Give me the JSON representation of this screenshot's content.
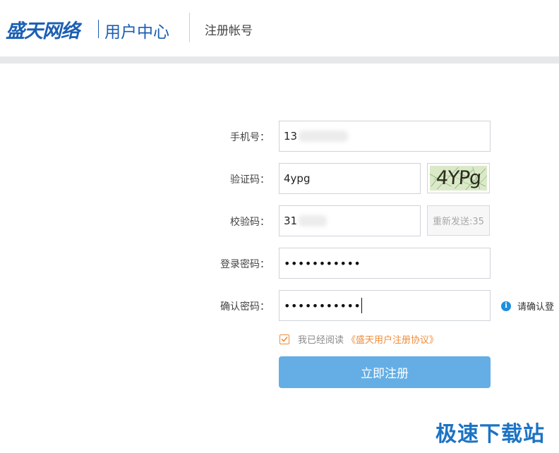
{
  "header": {
    "brand": "盛天网络",
    "subtitle": "用户中心",
    "page_title": "注册帐号"
  },
  "form": {
    "phone": {
      "label": "手机号：",
      "value": "13"
    },
    "captcha": {
      "label": "验证码：",
      "value": "4ypg",
      "image_text": "4YPg"
    },
    "verify_code": {
      "label": "校验码：",
      "value": "31",
      "resend_label": "重新发送:35"
    },
    "password": {
      "label": "登录密码：",
      "value": "•••••••••••"
    },
    "confirm_password": {
      "label": "确认密码：",
      "value": "•••••••••••"
    },
    "hint": {
      "icon": "info-icon",
      "text": "请确认登"
    },
    "agreement": {
      "prefix": "我已经阅读",
      "link": "《盛天用户注册协议》",
      "checked": true
    },
    "submit_label": "立即注册"
  },
  "watermark": "极速下载站",
  "colors": {
    "brand_blue": "#1a5fb4",
    "submit_blue": "#64aee5",
    "accent_orange": "#f08c3a",
    "info_blue": "#1d8fe0"
  }
}
